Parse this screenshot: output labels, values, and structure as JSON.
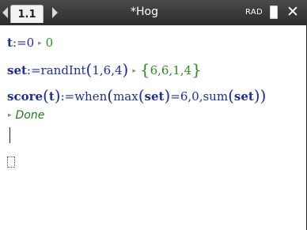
{
  "topbar": {
    "tab_label": "1.1",
    "document_title": "*Hog",
    "angle_mode": "RAD"
  },
  "history": [
    {
      "def_name": "t",
      "def_op": ":=",
      "def_value": "0",
      "result": "0"
    },
    {
      "def_name": "set",
      "def_op": ":=",
      "func": "randInt",
      "args": "1,6,4",
      "result_items": "6,6,1,4"
    },
    {
      "def_name": "score",
      "def_param": "t",
      "def_op": ":=",
      "func": "when",
      "inner_func1": "max",
      "inner_arg1": "set",
      "cond_tail": "=6,0,",
      "inner_func2": "sum",
      "inner_arg2": "set",
      "result": "Done"
    }
  ]
}
